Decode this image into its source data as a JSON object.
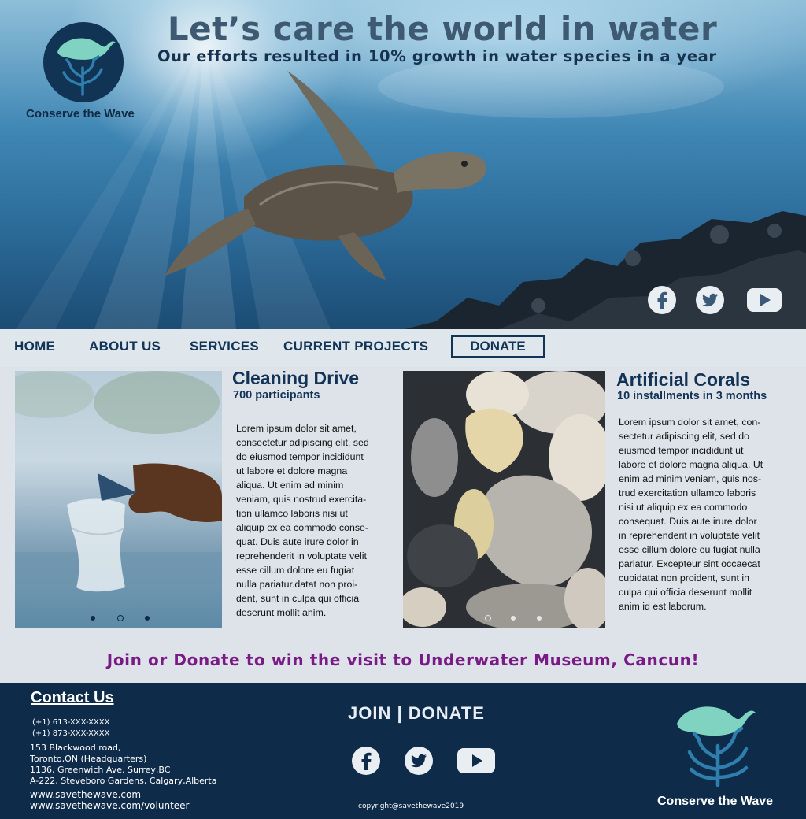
{
  "hero": {
    "title": "Let’s care the world in water",
    "subtitle": "Our efforts resulted in 10% growth in water species in a year",
    "brand": "Conserve the Wave"
  },
  "social": [
    "facebook-icon",
    "twitter-icon",
    "youtube-icon"
  ],
  "nav": {
    "items": [
      "HOME",
      "ABOUT US",
      "SERVICES",
      "CURRENT PROJECTS"
    ],
    "donate": "DONATE"
  },
  "cards": [
    {
      "title": "Cleaning Drive",
      "subtitle": "700 participants",
      "body": [
        "Lorem ipsum dolor sit amet,",
        "consectetur adipiscing elit, sed",
        "do eiusmod tempor incididunt",
        "ut labore et dolore magna",
        "aliqua. Ut enim ad minim",
        "veniam, quis nostrud exercita-",
        "tion ullamco laboris nisi ut",
        "aliquip ex ea commodo conse-",
        "quat. Duis aute irure dolor in",
        "reprehenderit in voluptate velit",
        "esse cillum dolore eu fugiat",
        "nulla pariatur.datat non proi-",
        "dent, sunt in culpa qui officia",
        "deserunt mollit anim."
      ],
      "slides": 3,
      "active_slide": 2
    },
    {
      "title": "Artificial Corals",
      "subtitle": "10 installments in 3 months",
      "body": [
        "Lorem ipsum dolor sit amet, con-",
        "sectetur adipiscing elit, sed do",
        "eiusmod tempor incididunt ut",
        "labore et dolore magna aliqua. Ut",
        "enim ad minim veniam, quis nos-",
        "trud exercitation ullamco laboris",
        "nisi ut aliquip ex ea commodo",
        "consequat. Duis aute irure dolor",
        "in reprehenderit in voluptate velit",
        "esse cillum dolore eu fugiat nulla",
        "pariatur. Excepteur sint occaecat",
        "cupidatat non proident, sunt in",
        "culpa qui officia deserunt mollit",
        "anim id est laborum."
      ],
      "slides": 3,
      "active_slide": 1
    }
  ],
  "promo": "Join or Donate to win the visit to Underwater Museum, Cancun!",
  "footer": {
    "contact_title": "Contact Us",
    "phones": [
      "(+1) 613-XXX-XXXX",
      "(+1) 873-XXX-XXXX"
    ],
    "address": [
      "153 Blackwood road,",
      "Toronto,ON (Headquarters)",
      "1136, Greenwich Ave. Surrey,BC",
      "A-222, Steveboro Gardens, Calgary,Alberta"
    ],
    "websites": [
      "www.savethewave.com",
      "www.savethewave.com/volunteer"
    ],
    "cta": "JOIN | DONATE",
    "copyright": "copyright@savethewave2019",
    "brand": "Conserve the Wave"
  },
  "colors": {
    "navy": "#123456",
    "footer_bg": "#0e2b4a",
    "promo": "#7a1a86",
    "logo_mint": "#7fd3c0",
    "logo_teal": "#2f7fae"
  }
}
